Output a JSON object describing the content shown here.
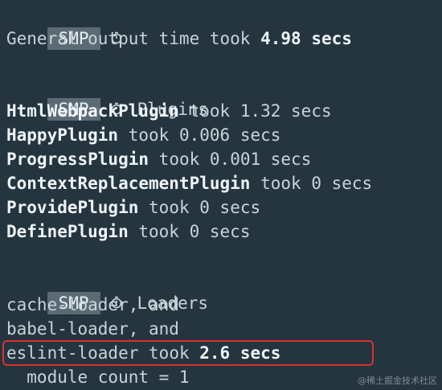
{
  "sections": [
    {
      "badge": "SMP",
      "title": "",
      "lines": [
        {
          "label": "General output time",
          "took": "took",
          "value": "4.98 secs",
          "label_bold": false,
          "value_bold": true
        }
      ]
    },
    {
      "badge": "SMP",
      "title": "Plugins",
      "lines": [
        {
          "label": "HtmlWebpackPlugin",
          "took": "took",
          "value": "1.32 secs",
          "label_bold": true,
          "value_bold": false
        },
        {
          "label": "HappyPlugin",
          "took": "took",
          "value": "0.006 secs",
          "label_bold": true,
          "value_bold": false
        },
        {
          "label": "ProgressPlugin",
          "took": "took",
          "value": "0.001 secs",
          "label_bold": true,
          "value_bold": false
        },
        {
          "label": "ContextReplacementPlugin",
          "took": "took",
          "value": "0 secs",
          "label_bold": true,
          "value_bold": false
        },
        {
          "label": "ProvidePlugin",
          "took": "took",
          "value": "0 secs",
          "label_bold": true,
          "value_bold": false
        },
        {
          "label": "DefinePlugin",
          "took": "took",
          "value": "0 secs",
          "label_bold": true,
          "value_bold": false
        }
      ]
    },
    {
      "badge": "SMP",
      "title": "Loaders",
      "lines": [
        {
          "text": "cache-loader, and"
        },
        {
          "text": "babel-loader, and"
        },
        {
          "label": "eslint-loader",
          "took": "took",
          "value": "2.6 secs",
          "label_bold": false,
          "value_bold": true,
          "highlighted": true
        },
        {
          "text": "  module count = 1"
        }
      ]
    }
  ],
  "watermark": "@稀土掘金技术社区",
  "icons": {
    "clock": "stopwatch-icon"
  },
  "colors": {
    "background": "#253540",
    "badge": "#5b6b76",
    "highlight_border": "#d9322f"
  }
}
